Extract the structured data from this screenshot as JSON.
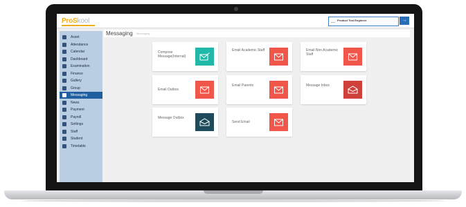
{
  "app": {
    "logo_part1": "ProS",
    "logo_part2": "kool",
    "user_name": "Product Test Engineer",
    "user_menu_glyph": "→"
  },
  "colors": {
    "teal": "#20b9a8",
    "red": "#f0574a",
    "dark_red": "#d0403a",
    "navy": "#1e4a5c",
    "sidebar": "#b9cde3",
    "active": "#1f5f9f"
  },
  "sidebar": {
    "items": [
      {
        "label": "Asset",
        "icon": "asset-icon"
      },
      {
        "label": "Attendance",
        "icon": "attendance-icon"
      },
      {
        "label": "Calendar",
        "icon": "calendar-icon"
      },
      {
        "label": "Dashboard",
        "icon": "dashboard-icon"
      },
      {
        "label": "Examination",
        "icon": "examination-icon"
      },
      {
        "label": "Finance",
        "icon": "finance-icon"
      },
      {
        "label": "Gallery",
        "icon": "gallery-icon"
      },
      {
        "label": "Group",
        "icon": "group-icon"
      },
      {
        "label": "Messaging",
        "icon": "envelope-icon",
        "active": true
      },
      {
        "label": "News",
        "icon": "news-icon"
      },
      {
        "label": "Payment",
        "icon": "payment-icon"
      },
      {
        "label": "Payroll",
        "icon": "payroll-icon"
      },
      {
        "label": "Settings",
        "icon": "settings-icon"
      },
      {
        "label": "Staff",
        "icon": "staff-icon"
      },
      {
        "label": "Student",
        "icon": "student-icon"
      },
      {
        "label": "Timetable",
        "icon": "timetable-icon"
      }
    ]
  },
  "page": {
    "title": "Messaging",
    "breadcrumb": "Messaging"
  },
  "tiles": [
    {
      "label": "Compose Message(Internal)",
      "icon": "compose-envelope-icon",
      "color": "#20b9a8"
    },
    {
      "label": "Email Academic Staff",
      "icon": "envelope-icon",
      "color": "#f0574a"
    },
    {
      "label": "Email Non Academic Staff",
      "icon": "envelope-icon",
      "color": "#f0574a"
    },
    {
      "label": "Email Outbox",
      "icon": "envelope-icon",
      "color": "#f0574a"
    },
    {
      "label": "Email Parents",
      "icon": "envelope-icon",
      "color": "#f0574a"
    },
    {
      "label": "Message Inbox",
      "icon": "open-envelope-icon",
      "color": "#d0403a"
    },
    {
      "label": "Message Outbox",
      "icon": "open-envelope-icon",
      "color": "#1e4a5c"
    },
    {
      "label": "Send Email",
      "icon": "envelope-icon",
      "color": "#f0574a"
    }
  ]
}
